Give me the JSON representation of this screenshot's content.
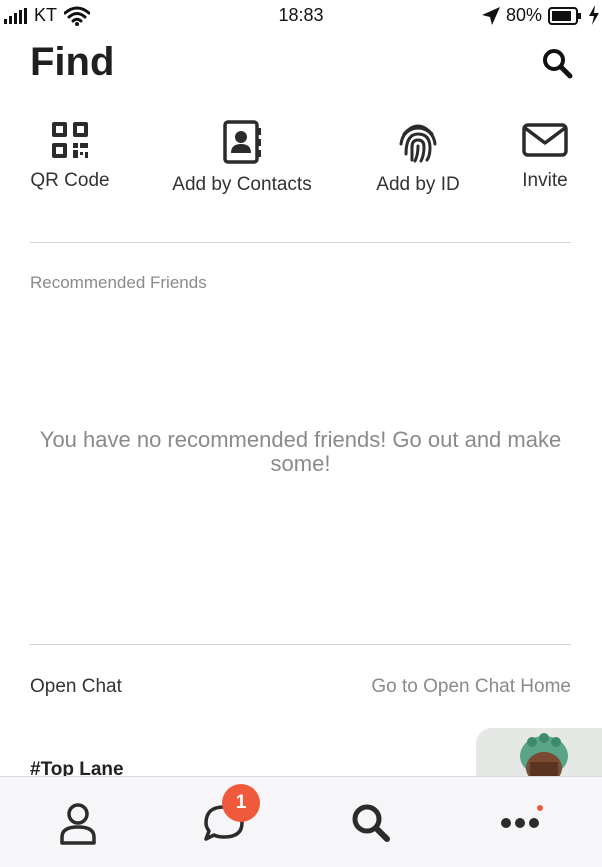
{
  "status_bar": {
    "carrier": "KT",
    "time": "18:83",
    "battery": "80%",
    "icons": [
      "signal-icon",
      "wifi-icon",
      "location-arrow-icon",
      "battery-icon",
      "charging-bolt-icon"
    ]
  },
  "header": {
    "title": "Find",
    "search_icon": "search-icon"
  },
  "quick_actions": [
    {
      "label": "QR Code",
      "icon": "qr-code-icon"
    },
    {
      "label": "Add by Contacts",
      "icon": "contacts-book-icon"
    },
    {
      "label": "Add by ID",
      "icon": "fingerprint-icon"
    },
    {
      "label": "Invite",
      "icon": "envelope-icon"
    }
  ],
  "recommended": {
    "label": "Recommended Friends",
    "empty_message": "You have no recommended friends! Go out and make some!"
  },
  "open_chat": {
    "label": "Open Chat",
    "link": "Go to Open Chat Home",
    "items": [
      {
        "title": "#Top Lane"
      }
    ]
  },
  "tab_bar": {
    "tabs": [
      {
        "icon": "person-icon",
        "badge": ""
      },
      {
        "icon": "chat-bubble-icon",
        "badge": "1"
      },
      {
        "icon": "search-icon",
        "badge": ""
      },
      {
        "icon": "more-dots-icon",
        "badge": ""
      }
    ]
  },
  "colors": {
    "badge": "#f05a3c",
    "text_primary": "#222222",
    "text_secondary": "#8a8a8a",
    "divider": "#d4d4d4",
    "tab_bar_bg": "#f6f6f8"
  }
}
